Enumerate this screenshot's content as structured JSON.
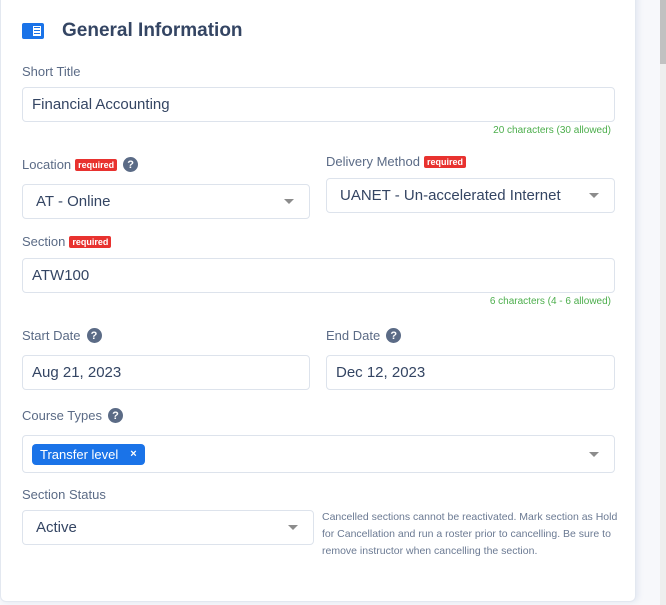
{
  "header": {
    "title": "General Information",
    "icon": "document-icon"
  },
  "required_badge": "required",
  "help_glyph": "?",
  "fields": {
    "short_title": {
      "label": "Short Title",
      "value": "Financial Accounting",
      "hint": "20 characters (30 allowed)"
    },
    "location": {
      "label": "Location",
      "value": "AT - Online"
    },
    "delivery_method": {
      "label": "Delivery Method",
      "value": "UANET - Un-accelerated Internet"
    },
    "section": {
      "label": "Section",
      "value": "ATW100",
      "hint": "6 characters (4 - 6 allowed)"
    },
    "start_date": {
      "label": "Start Date",
      "value": "Aug 21, 2023"
    },
    "end_date": {
      "label": "End Date",
      "value": "Dec 12, 2023"
    },
    "course_types": {
      "label": "Course Types",
      "chips": [
        {
          "label": "Transfer level",
          "remove": "×"
        }
      ]
    },
    "section_status": {
      "label": "Section Status",
      "value": "Active",
      "note": "Cancelled sections cannot be reactivated. Mark section as Hold for Cancellation and run a roster prior to cancelling. Be sure to remove instructor when cancelling the section."
    }
  },
  "colors": {
    "accent": "#1a73e8",
    "required": "#e8322f",
    "hint": "#4cae4c",
    "text": "#344563"
  }
}
